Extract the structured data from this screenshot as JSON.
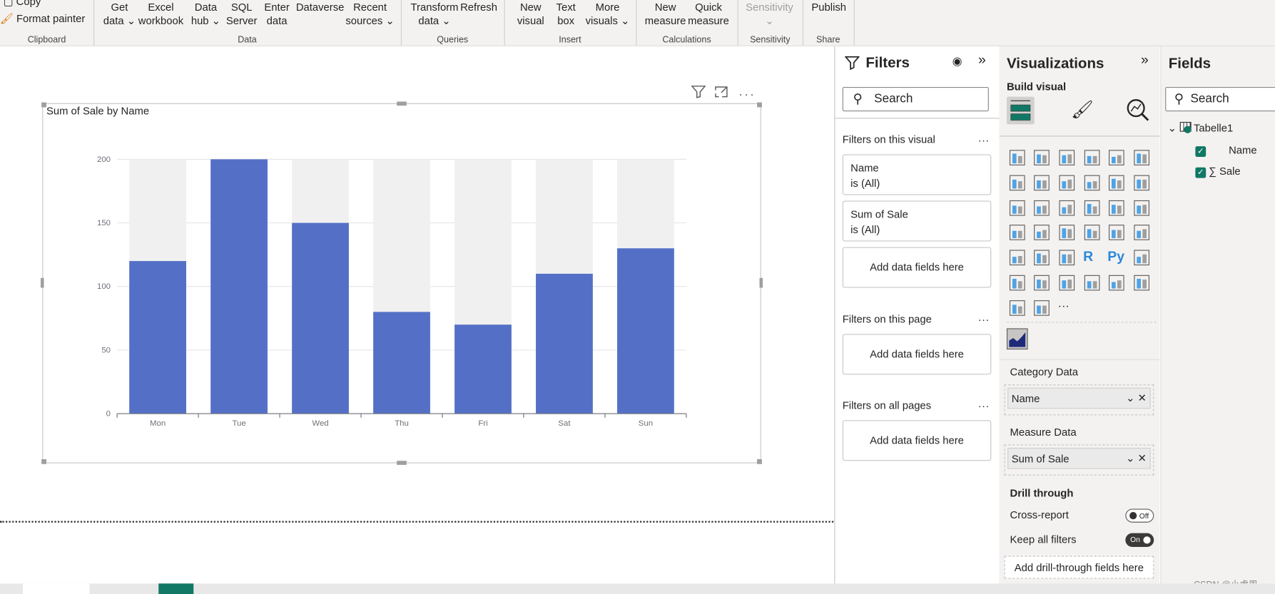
{
  "ribbon": {
    "clipboard": {
      "copy": "Copy",
      "format_painter": "Format painter",
      "label": "Clipboard"
    },
    "data": {
      "label": "Data",
      "buttons": [
        "Get\ndata ⌄",
        "Excel\nworkbook",
        "Data\nhub ⌄",
        "SQL\nServer",
        "Enter\ndata",
        "Dataverse",
        "Recent\nsources ⌄"
      ]
    },
    "queries": {
      "label": "Queries",
      "buttons": [
        "Transform\ndata ⌄",
        "Refresh"
      ]
    },
    "insert": {
      "label": "Insert",
      "buttons": [
        "New\nvisual",
        "Text\nbox",
        "More\nvisuals ⌄"
      ]
    },
    "calculations": {
      "label": "Calculations",
      "buttons": [
        "New\nmeasure",
        "Quick\nmeasure"
      ]
    },
    "sensitivity": {
      "label": "Sensitivity",
      "buttons": [
        "Sensitivity\n⌄"
      ]
    },
    "share": {
      "label": "Share",
      "buttons": [
        "Publish"
      ]
    }
  },
  "visual": {
    "title": "Sum of Sale by Name",
    "header_icons": [
      "filter-icon",
      "focus-mode-icon",
      "more-options-icon"
    ]
  },
  "chart_data": {
    "type": "bar",
    "title": "Sum of Sale by Name",
    "categories": [
      "Mon",
      "Tue",
      "Wed",
      "Thu",
      "Fri",
      "Sat",
      "Sun"
    ],
    "values": [
      120,
      200,
      150,
      80,
      70,
      110,
      130
    ],
    "ylim": [
      0,
      200
    ],
    "yticks": [
      "0",
      "50",
      "100",
      "150",
      "200"
    ],
    "grid": true,
    "bar_color": "#5470c6",
    "background_bar_color": "#f0f0f0"
  },
  "filters": {
    "title": "Filters",
    "search_placeholder": "Search",
    "on_visual": "Filters on this visual",
    "cards": [
      {
        "field": "Name",
        "state": "is (All)"
      },
      {
        "field": "Sum of Sale",
        "state": "is (All)"
      }
    ],
    "add_fields": "Add data fields here",
    "on_page": "Filters on this page",
    "on_all": "Filters on all pages",
    "more": "..."
  },
  "viz": {
    "title": "Visualizations",
    "build_visual": "Build visual",
    "icons": [
      "stacked-bar",
      "stacked-column",
      "clustered-bar",
      "clustered-column",
      "100-bar",
      "100-column",
      "line",
      "area",
      "stacked-area",
      "line-column",
      "line-clustered",
      "ribbon",
      "waterfall",
      "funnel",
      "scatter",
      "pie",
      "donut",
      "treemap",
      "map",
      "filled-map",
      "gauge",
      "card",
      "multi-row-card",
      "kpi",
      "slicer",
      "table",
      "matrix",
      "r-visual",
      "python-visual",
      "key-influencers",
      "decomposition-tree",
      "qa",
      "narrative",
      "goals",
      "paginated",
      "azure-map",
      "power-apps",
      "power-automate",
      "more"
    ],
    "category_label": "Category Data",
    "category_field": "Name",
    "measure_label": "Measure Data",
    "measure_field": "Sum of Sale",
    "drill_through": "Drill through",
    "cross_report": "Cross-report",
    "cross_report_state": "Off",
    "keep_filters": "Keep all filters",
    "keep_filters_state": "On",
    "add_drill": "Add drill-through fields here"
  },
  "fields": {
    "title": "Fields",
    "search_placeholder": "Search",
    "table": "Tabelle1",
    "items": [
      {
        "name": "Name",
        "checked": true,
        "sigma": false
      },
      {
        "name": "Sale",
        "checked": true,
        "sigma": true
      }
    ]
  },
  "watermark": "CSDN @小虎周",
  "accent": "#117865"
}
